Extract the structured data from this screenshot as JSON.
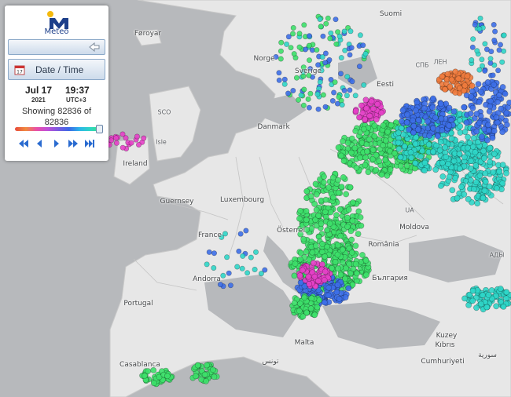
{
  "panel": {
    "logo_text": "Meteo",
    "datetime_label": "Date / Time",
    "date": "Jul 17",
    "year": "2021",
    "time": "19:37",
    "timezone": "UTC+3",
    "showing_line1": "Showing 82836 of",
    "showing_line2": "82836",
    "slider_value": 1.0
  },
  "icons": {
    "back": "arrow-left-icon",
    "calendar": "calendar-icon",
    "first": "skip-back-icon",
    "prev": "step-back-icon",
    "play": "play-icon",
    "next": "fast-forward-icon",
    "last": "skip-forward-icon"
  },
  "colors": {
    "brand": "#1d3f8a",
    "logo_dot": "#f4b90d",
    "land": "#e8e8e8",
    "sea": "#b7b9bc",
    "marker_green": "#3de06a",
    "marker_cyan": "#2fd6c8",
    "marker_blue": "#3d6fe8",
    "marker_magenta": "#e640c8",
    "marker_orange": "#ef7b3d"
  },
  "map_labels": {
    "faroe": "Føroyar",
    "norge": "Norge",
    "sverige": "Sverige",
    "suomi": "Suomi",
    "eesti": "Eesti",
    "danmark": "Danmark",
    "ireland": "Ireland",
    "isle": "Isle",
    "guernsey": "Guernsey",
    "luxembourg": "Luxembourg",
    "france": "France",
    "osterreich": "Österrei",
    "andorra": "Andorra",
    "portugal": "Portugal",
    "malta": "Malta",
    "romania": "România",
    "moldova": "Moldova",
    "bulgaria": "България",
    "kuzey": "Kuzey",
    "kibris": "Kıbrıs",
    "cumhuriyeti": "Cumhuriyeti",
    "suriya": "سورية",
    "tunis": "تونس",
    "casablanca": "Casablanca",
    "spb": "СПБ",
    "len": "ЛЕН",
    "sco": "SCO",
    "ua": "UA",
    "ads": "АДЫ"
  }
}
